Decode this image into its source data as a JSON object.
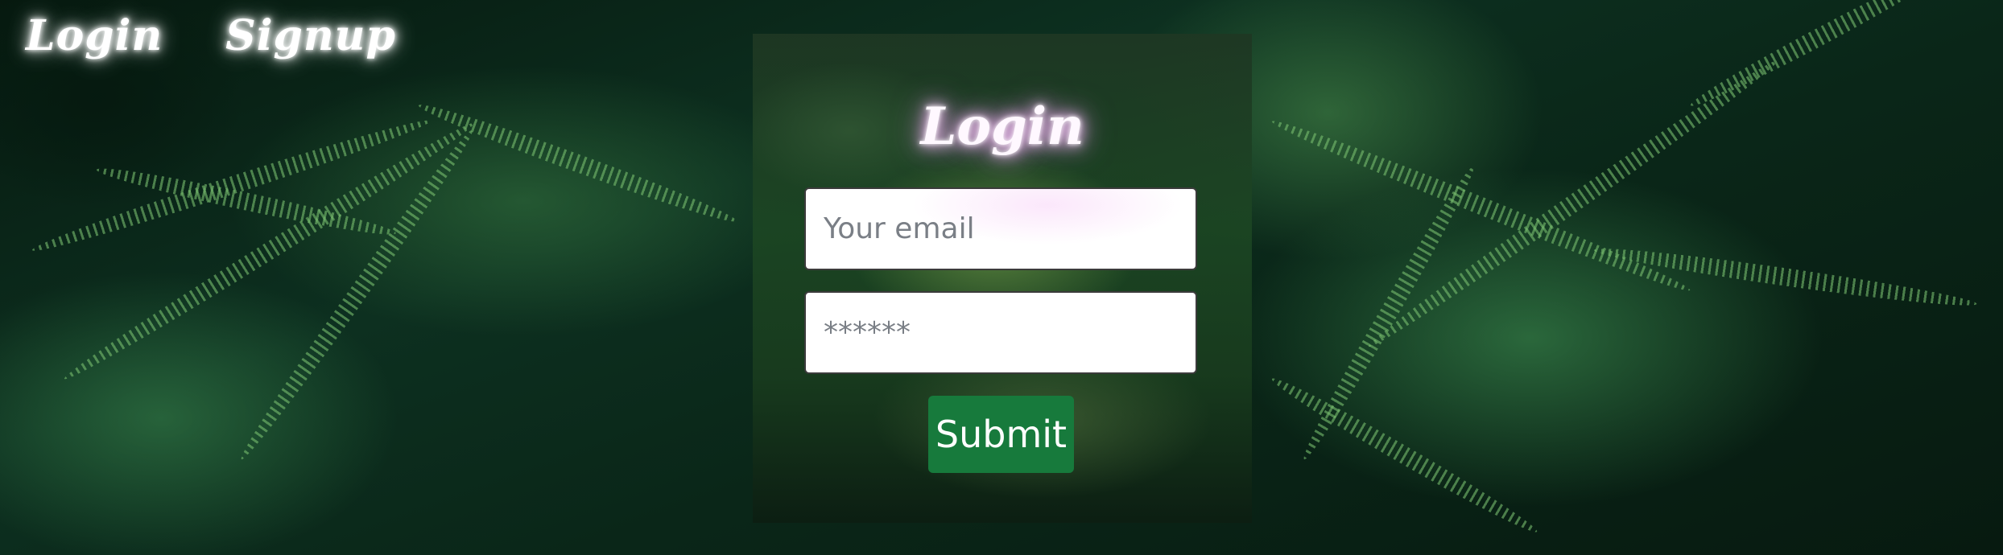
{
  "nav": {
    "login_label": "Login",
    "signup_label": "Signup"
  },
  "form": {
    "title": "Login",
    "email": {
      "placeholder": "Your email",
      "value": ""
    },
    "password": {
      "placeholder": "******",
      "value": ""
    },
    "submit_label": "Submit"
  },
  "colors": {
    "submit_button": "#177a3c",
    "title_glow": "#e89cec",
    "nav_glow": "#ffffff"
  }
}
